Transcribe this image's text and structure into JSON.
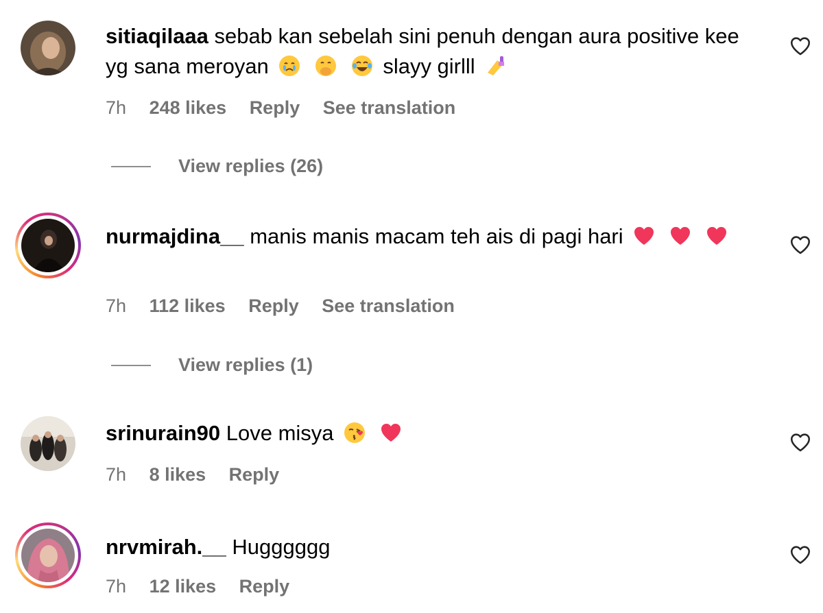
{
  "comments": [
    {
      "username": "sitiaqilaaa",
      "text_part1": "sebab kan sebelah sini penuh dengan aura positive kee yg sana meroyan",
      "emojis_mid": [
        "crying-face-emoji",
        "hand-over-mouth-emoji",
        "tears-of-joy-emoji"
      ],
      "text_part2": "slayy girlll",
      "emojis_end": [
        "nail-polish-emoji"
      ],
      "time": "7h",
      "likes": "248 likes",
      "reply": "Reply",
      "translate": "See translation",
      "view_replies": "View replies (26)"
    },
    {
      "username": "nurmajdina__",
      "text_part1": "manis manis macam teh ais di pagi hari",
      "emojis_end": [
        "heart-emoji",
        "heart-emoji",
        "heart-emoji"
      ],
      "time": "7h",
      "likes": "112 likes",
      "reply": "Reply",
      "translate": "See translation",
      "view_replies": "View replies (1)"
    },
    {
      "username": "srinurain90",
      "text_part1": "Love misya",
      "emojis_end": [
        "kissing-face-emoji",
        "heart-emoji"
      ],
      "time": "7h",
      "likes": "8 likes",
      "reply": "Reply"
    },
    {
      "username": "nrvmirah.__",
      "text_part1": "Hugggggg",
      "time": "7h",
      "likes": "12 likes",
      "reply": "Reply"
    }
  ],
  "colors": {
    "meta_gray": "#737373",
    "heart_red": "#f0365a",
    "emoji_yellow": "#ffc83d"
  }
}
